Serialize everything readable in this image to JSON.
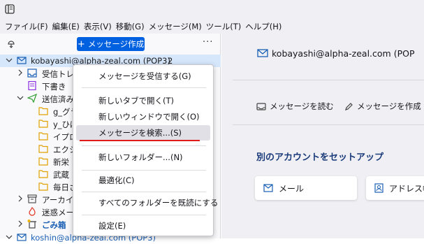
{
  "menubar": {
    "items": [
      "ファイル(F)",
      "編集(E)",
      "表示(V)",
      "移動(G)",
      "メッセージ(M)",
      "ツール(T)",
      "ヘルプ(H)"
    ]
  },
  "toolbar": {
    "new_message_label": "メッセージ作成",
    "more_label": "···"
  },
  "folders": {
    "account1": {
      "label": "kobayashi@alpha-zeal.com (POP3)",
      "unread": "2"
    },
    "inbox": "受信トレ",
    "drafts": "下書き",
    "sent": "送信済み",
    "sub": [
      "g_グラ",
      "y_ひば",
      "イプロ",
      "エクシ",
      "新栄",
      "武蔵",
      "毎日さ"
    ],
    "archives": "アーカイブ",
    "junk": "迷惑メー",
    "trash": "ごみ箱",
    "account2": "koshin@alpha-zeal.com (POP3)"
  },
  "context_menu": {
    "items": [
      "メッセージを受信する(G)",
      "新しいタブで開く(T)",
      "新しいウィンドウで開く(O)",
      "メッセージを検索...(S)",
      "新しいフォルダー...(N)",
      "最適化(C)",
      "すべてのフォルダーを既読にする",
      "設定(E)"
    ],
    "highlighted": "メッセージを検索...(S)"
  },
  "account_central": {
    "title": "kobayashi@alpha-zeal.com (POP",
    "actions": {
      "read": "メッセージを読む",
      "write": "メッセージを作成"
    },
    "setup_title": "別のアカウントをセットアップ",
    "setup_options": {
      "mail": "メール",
      "address_book": "アドレス帳"
    }
  },
  "colors": {
    "accent": "#0061e0",
    "selection": "#d6e6fb",
    "highlight_line": "#e01b1b",
    "section_title": "#1a3a7a"
  },
  "icons": [
    "app-menu-icon",
    "get-mail-icon",
    "twisty-icon",
    "account-mail-icon",
    "inbox-icon",
    "drafts-icon",
    "sent-icon",
    "folder-icon",
    "archive-icon",
    "junk-icon",
    "trash-icon",
    "read-icon",
    "pencil-icon",
    "mail-icon",
    "address-book-icon"
  ]
}
